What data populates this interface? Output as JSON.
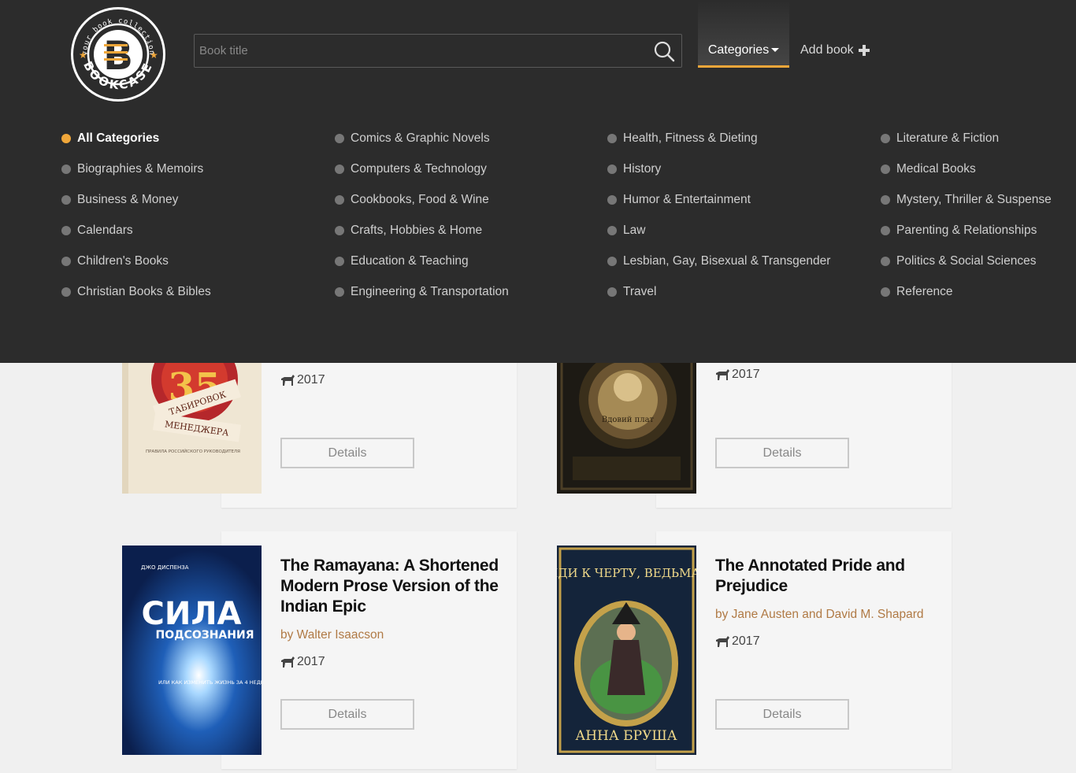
{
  "header": {
    "logo": {
      "ring_text": "your book collection",
      "name": "BOOKCASE",
      "letter": "B"
    },
    "search": {
      "placeholder": "Book title"
    },
    "nav": {
      "categories_label": "Categories",
      "add_book_label": "Add book"
    }
  },
  "categories": [
    [
      "All Categories",
      "Biographies & Memoirs",
      "Business & Money",
      "Calendars",
      "Children's Books",
      "Christian Books & Bibles"
    ],
    [
      "Comics & Graphic Novels",
      "Computers & Technology",
      "Cookbooks, Food & Wine",
      "Crafts, Hobbies & Home",
      "Education & Teaching",
      "Engineering & Transportation"
    ],
    [
      "Health, Fitness & Dieting",
      "History",
      "Humor & Entertainment",
      "Law",
      "Lesbian, Gay, Bisexual & Transgender",
      "Travel"
    ],
    [
      "Literature & Fiction",
      "Medical Books",
      "Mystery, Thriller & Suspense",
      "Parenting & Relationships",
      "Politics & Social Sciences",
      "Reference"
    ]
  ],
  "active_category": "All Categories",
  "books": [
    {
      "year": "2017",
      "details_label": "Details",
      "cover_text": [
        "ТАБИРОВОК",
        "МЕНЕДЖЕРА",
        "ПРАВИЛА РОССИЙСКОГО РУКОВОДИТЕЛЯ"
      ]
    },
    {
      "year": "2017",
      "details_label": "Details",
      "cover_text": [
        "Вдовий плат"
      ]
    },
    {
      "title": "The Ramayana: A Shortened Modern Prose Version of the Indian Epic",
      "author": "by Walter Isaacson",
      "year": "2017",
      "details_label": "Details",
      "cover_text": [
        "ДЖО ДИСПЕНЗА",
        "СИЛА",
        "ПОДСОЗНАНИЯ",
        "ИЛИ КАК ИЗМЕНИТЬ ЖИЗНЬ ЗА 4 НЕДЕЛИ"
      ]
    },
    {
      "title": "The Annotated Pride and Prejudice",
      "author": "by Jane Austen and David M. Shapard",
      "year": "2017",
      "details_label": "Details",
      "cover_text": [
        "ИДИ К ЧЕРТУ, ВЕДЬМА!",
        "АННА БРУША"
      ]
    }
  ],
  "colors": {
    "header_bg": "#2c2c2c",
    "accent": "#f0a73a",
    "author": "#b07a45",
    "page_bg": "#f0f0f0",
    "card_bg": "#f5f5f5"
  }
}
